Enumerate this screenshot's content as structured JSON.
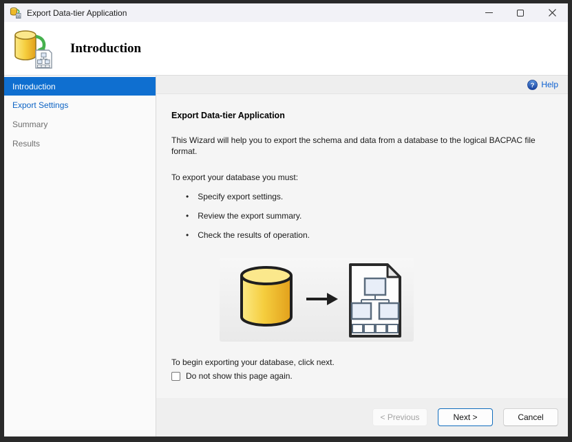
{
  "window": {
    "title": "Export Data-tier Application",
    "controls": {
      "minimize": "minimize",
      "maximize": "maximize",
      "close": "close"
    }
  },
  "header": {
    "title": "Introduction"
  },
  "sidebar": {
    "items": [
      {
        "label": "Introduction",
        "state": "selected"
      },
      {
        "label": "Export Settings",
        "state": "enabled"
      },
      {
        "label": "Summary",
        "state": "disabled"
      },
      {
        "label": "Results",
        "state": "disabled"
      }
    ]
  },
  "content": {
    "help": {
      "label": "Help",
      "icon": "help-circle-icon"
    },
    "heading": "Export Data-tier Application",
    "description": "This Wizard will help you to export the schema and data from a database to the logical BACPAC file format.",
    "requirements_intro": "To export your database you must:",
    "requirements": [
      "Specify export settings.",
      "Review the export summary.",
      "Check the results of operation."
    ],
    "illustration": {
      "from_icon": "database-cylinder-icon",
      "arrow_icon": "right-arrow-icon",
      "to_icon": "bacpac-document-icon"
    },
    "begin_hint": "To begin exporting your database, click next.",
    "dont_show_again": {
      "label": "Do not show this page again.",
      "checked": false
    }
  },
  "footer": {
    "previous_label": "< Previous",
    "next_label": "Next >",
    "cancel_label": "Cancel"
  },
  "colors": {
    "selected_nav_bg": "#0f6fd0",
    "nav_link_blue": "#0c63c4",
    "help_link_blue": "#0b5fd0",
    "next_button_border": "#0f6cbd",
    "titlebar_bg": "#f2f2f7",
    "frame_dark": "#2a2a2a",
    "db_gold": "#f0c330"
  }
}
